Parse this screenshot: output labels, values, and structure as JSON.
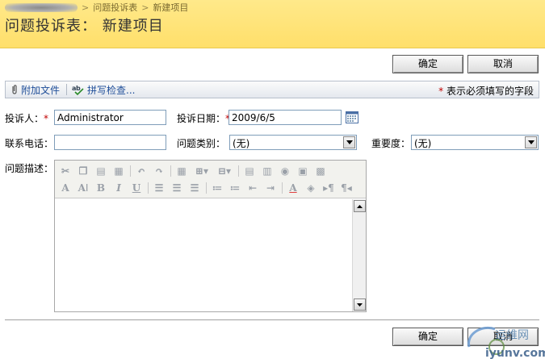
{
  "header": {
    "breadcrumb": [
      "问题投诉表",
      "新建项目"
    ],
    "title": "问题投诉表： 新建项目"
  },
  "buttons": {
    "ok_label": "确定",
    "cancel_label": "取消"
  },
  "toolbar": {
    "attach_label": "附加文件",
    "spellcheck_label": "拼写检查...",
    "required_note": "表示必须填写的字段"
  },
  "form": {
    "complainant_label": "投诉人：",
    "complainant_value": "Administrator",
    "date_label": "投诉日期：",
    "date_value": "2009/6/5",
    "phone_label": "联系电话：",
    "phone_value": "",
    "category_label": "问题类别：",
    "category_value": "(无)",
    "importance_label": "重要度：",
    "importance_value": "(无)",
    "description_label": "问题描述："
  },
  "watermark": {
    "cn": "运维网",
    "url": "iyunv.com"
  },
  "colors": {
    "header_bg": "#ffe27a",
    "link": "#1f4e99",
    "required": "#c00000"
  }
}
